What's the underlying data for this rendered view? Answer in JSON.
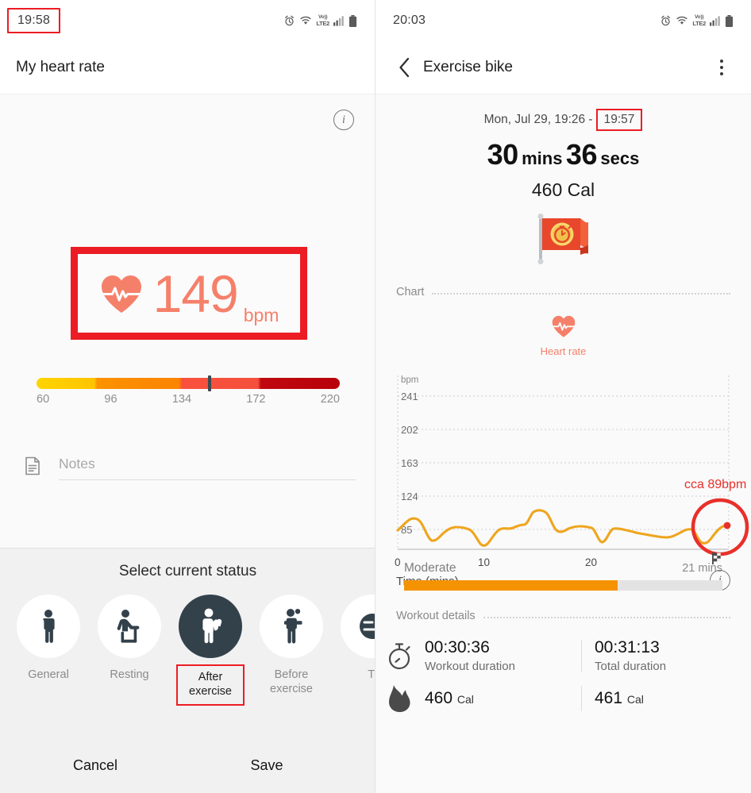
{
  "left": {
    "status_bar": {
      "time": "19:58",
      "icons": [
        "alarm-icon",
        "wifi-icon",
        "volte-icon",
        "signal-icon",
        "battery-icon"
      ],
      "volte_top": "Vo))",
      "volte_bottom": "LTE2"
    },
    "app_bar": {
      "title": "My heart rate"
    },
    "info_icon": "i",
    "heart_rate": {
      "value": "149",
      "unit": "bpm",
      "icon": "heart-pulse-icon",
      "accent": "#F5806A",
      "highlight": "#EC1C24"
    },
    "scale": {
      "ticks": [
        "60",
        "96",
        "134",
        "172",
        "220"
      ],
      "marker_percent": 56.5,
      "colors": [
        "#FFD400",
        "#FB9200",
        "#F9503C",
        "#C00810"
      ]
    },
    "notes": {
      "placeholder": "Notes",
      "value": "",
      "icon": "note-document-icon"
    },
    "sheet": {
      "title": "Select current status",
      "options": [
        {
          "label": "General",
          "icon": "person-standing-icon",
          "selected": false
        },
        {
          "label": "Resting",
          "icon": "person-sitting-icon",
          "selected": false
        },
        {
          "label": "After\nexercise",
          "label_line1": "After",
          "label_line2": "exercise",
          "icon": "person-flexing-icon",
          "selected": true
        },
        {
          "label": "Before\nexercise",
          "label_line1": "Before",
          "label_line2": "exercise",
          "icon": "person-towel-icon",
          "selected": false
        },
        {
          "label": "Ti",
          "label_line1": "Ti",
          "label_line2": "",
          "icon": "person-tired-icon",
          "selected": false
        }
      ],
      "cancel_label": "Cancel",
      "save_label": "Save"
    }
  },
  "right": {
    "status_bar": {
      "time": "20:03",
      "icons": [
        "alarm-icon",
        "wifi-icon",
        "volte-icon",
        "signal-icon",
        "battery-icon"
      ],
      "volte_top": "Vo))",
      "volte_bottom": "LTE2"
    },
    "app_bar": {
      "title": "Exercise bike",
      "back_icon": "chevron-left-icon",
      "menu_icon": "kebab-menu-icon"
    },
    "summary": {
      "date_text": "Mon, Jul 29, 19:26 -",
      "end_time": "19:57",
      "duration_value_1": "30",
      "duration_unit_1": "mins",
      "duration_value_2": "36",
      "duration_unit_2": "secs",
      "calories": "460 Cal",
      "badge_icon": "flag-stopwatch-medal-icon"
    },
    "chart_section_label": "Chart",
    "legend": {
      "label": "Heart rate",
      "icon": "heart-pulse-icon",
      "color": "#F5806A"
    },
    "chart_annotation": "cca 89bpm",
    "x_axis_label": "Time (mins)",
    "chart_info_icon": "i",
    "chart_end_icon": "checkered-flag-icon",
    "intensity": {
      "label": "Moderate",
      "value": "21 mins",
      "percent": 67,
      "color": "#F59200"
    },
    "details_section_label": "Workout details",
    "details": [
      {
        "icon": "stopwatch-icon",
        "left_value": "00:30:36",
        "left_unit": "",
        "left_label": "Workout duration",
        "right_value": "00:31:13",
        "right_unit": "",
        "right_label": "Total duration"
      },
      {
        "icon": "flame-icon",
        "left_value": "460",
        "left_unit": "Cal",
        "left_label": "",
        "right_value": "461",
        "right_unit": "Cal",
        "right_label": ""
      }
    ]
  },
  "chart_data": {
    "type": "line",
    "title": "Heart rate",
    "xlabel": "Time (mins)",
    "ylabel": "bpm",
    "ylim": [
      46,
      241
    ],
    "xlim": [
      0,
      31
    ],
    "yticks": [
      85,
      124,
      163,
      202,
      241
    ],
    "xticks": [
      0,
      10,
      20
    ],
    "grid": true,
    "legend": [
      "Heart rate"
    ],
    "line_color": "#EFA51E",
    "annotation": "cca 89bpm",
    "annotation_point": {
      "x": 30.6,
      "y": 89
    },
    "series": [
      {
        "name": "Heart rate",
        "x": [
          0,
          0.7,
          1.4,
          2.1,
          2.8,
          3.5,
          4.2,
          4.9,
          5.6,
          6.3,
          7.0,
          7.7,
          8.4,
          9.1,
          9.8,
          10.5,
          11.2,
          11.9,
          12.6,
          13.3,
          14.0,
          14.7,
          15.4,
          16.1,
          16.8,
          17.5,
          18.2,
          18.9,
          19.6,
          20.3,
          21.0,
          21.7,
          22.4,
          23.1,
          23.8,
          24.5,
          25.2,
          25.9,
          26.6,
          27.3,
          28.0,
          28.7,
          29.4,
          30.1,
          30.6
        ],
        "y": [
          86,
          93,
          97,
          95,
          84,
          72,
          74,
          84,
          90,
          91,
          90,
          83,
          66,
          82,
          93,
          90,
          88,
          93,
          97,
          97,
          112,
          114,
          104,
          87,
          92,
          97,
          98,
          98,
          97,
          94,
          71,
          96,
          96,
          94,
          93,
          91,
          89,
          87,
          86,
          85,
          91,
          84,
          74,
          86,
          89
        ]
      }
    ]
  }
}
